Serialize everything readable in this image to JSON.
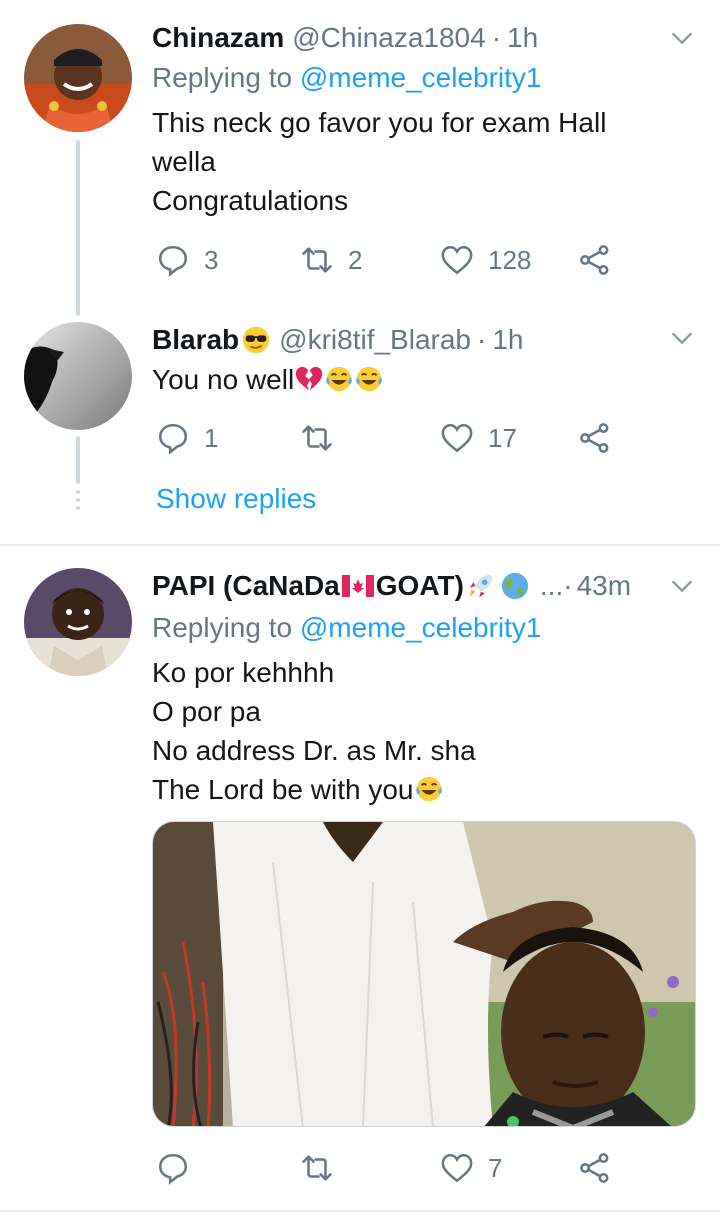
{
  "tweets": [
    {
      "name": "Chinazam",
      "handle": "@Chinaza1804",
      "sep": "·",
      "time": "1h",
      "replying_label": "Replying to",
      "replying_to": "@meme_celebrity1",
      "lines": [
        "This neck go favor you for exam Hall",
        "wella",
        "Congratulations"
      ],
      "replies": "3",
      "retweets": "2",
      "likes": "128"
    },
    {
      "name": "Blarab",
      "handle": "@kri8tif_Blarab",
      "sep": "·",
      "time": "1h",
      "text": "You no well",
      "replies": "1",
      "retweets": "",
      "likes": "17",
      "show_replies": "Show replies"
    },
    {
      "name_prefix": "PAPI (CaNaDa",
      "name_suffix": " GOAT)",
      "ellipsis": "...",
      "sep": "·",
      "time": "43m",
      "replying_label": "Replying to",
      "replying_to": "@meme_celebrity1",
      "lines": [
        "Ko por kehhhh",
        "O por pa",
        "No address Dr. as Mr. sha",
        "The Lord be with you"
      ],
      "replies": "",
      "retweets": "",
      "likes": "7"
    }
  ],
  "colors": {
    "accent": "#1da1f2",
    "muted": "#657786",
    "text": "#14171a",
    "thread": "#cfd9de"
  }
}
